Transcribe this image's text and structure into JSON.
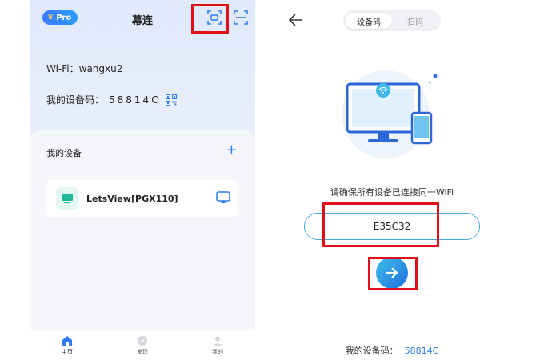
{
  "left_app": {
    "pro_badge": "Pro",
    "title": "幕连",
    "wifi_label": "Wi-Fi：",
    "wifi_name": "wangxu2",
    "device_code_label": "我的设备码：",
    "device_code": "58814C",
    "devices_section": {
      "title": "我的设备",
      "add_label": "+",
      "devices": [
        {
          "name": "LetsView[PGX110]"
        }
      ]
    },
    "nav": [
      {
        "label": "主页",
        "icon": "home-icon",
        "active": true
      },
      {
        "label": "发现",
        "icon": "compass-icon",
        "active": false
      },
      {
        "label": "我的",
        "icon": "user-icon",
        "active": false
      }
    ],
    "highlight_color": "#e0101a"
  },
  "right_app": {
    "tabs": [
      {
        "label": "设备码",
        "active": true
      },
      {
        "label": "扫码",
        "active": false
      }
    ],
    "hint": "请确保所有设备已连接同一WiFi",
    "code_input_value": "E35C32",
    "my_code_label": "我的设备码：",
    "my_code_value": "58814C",
    "accent_color": "#2a7be6"
  }
}
